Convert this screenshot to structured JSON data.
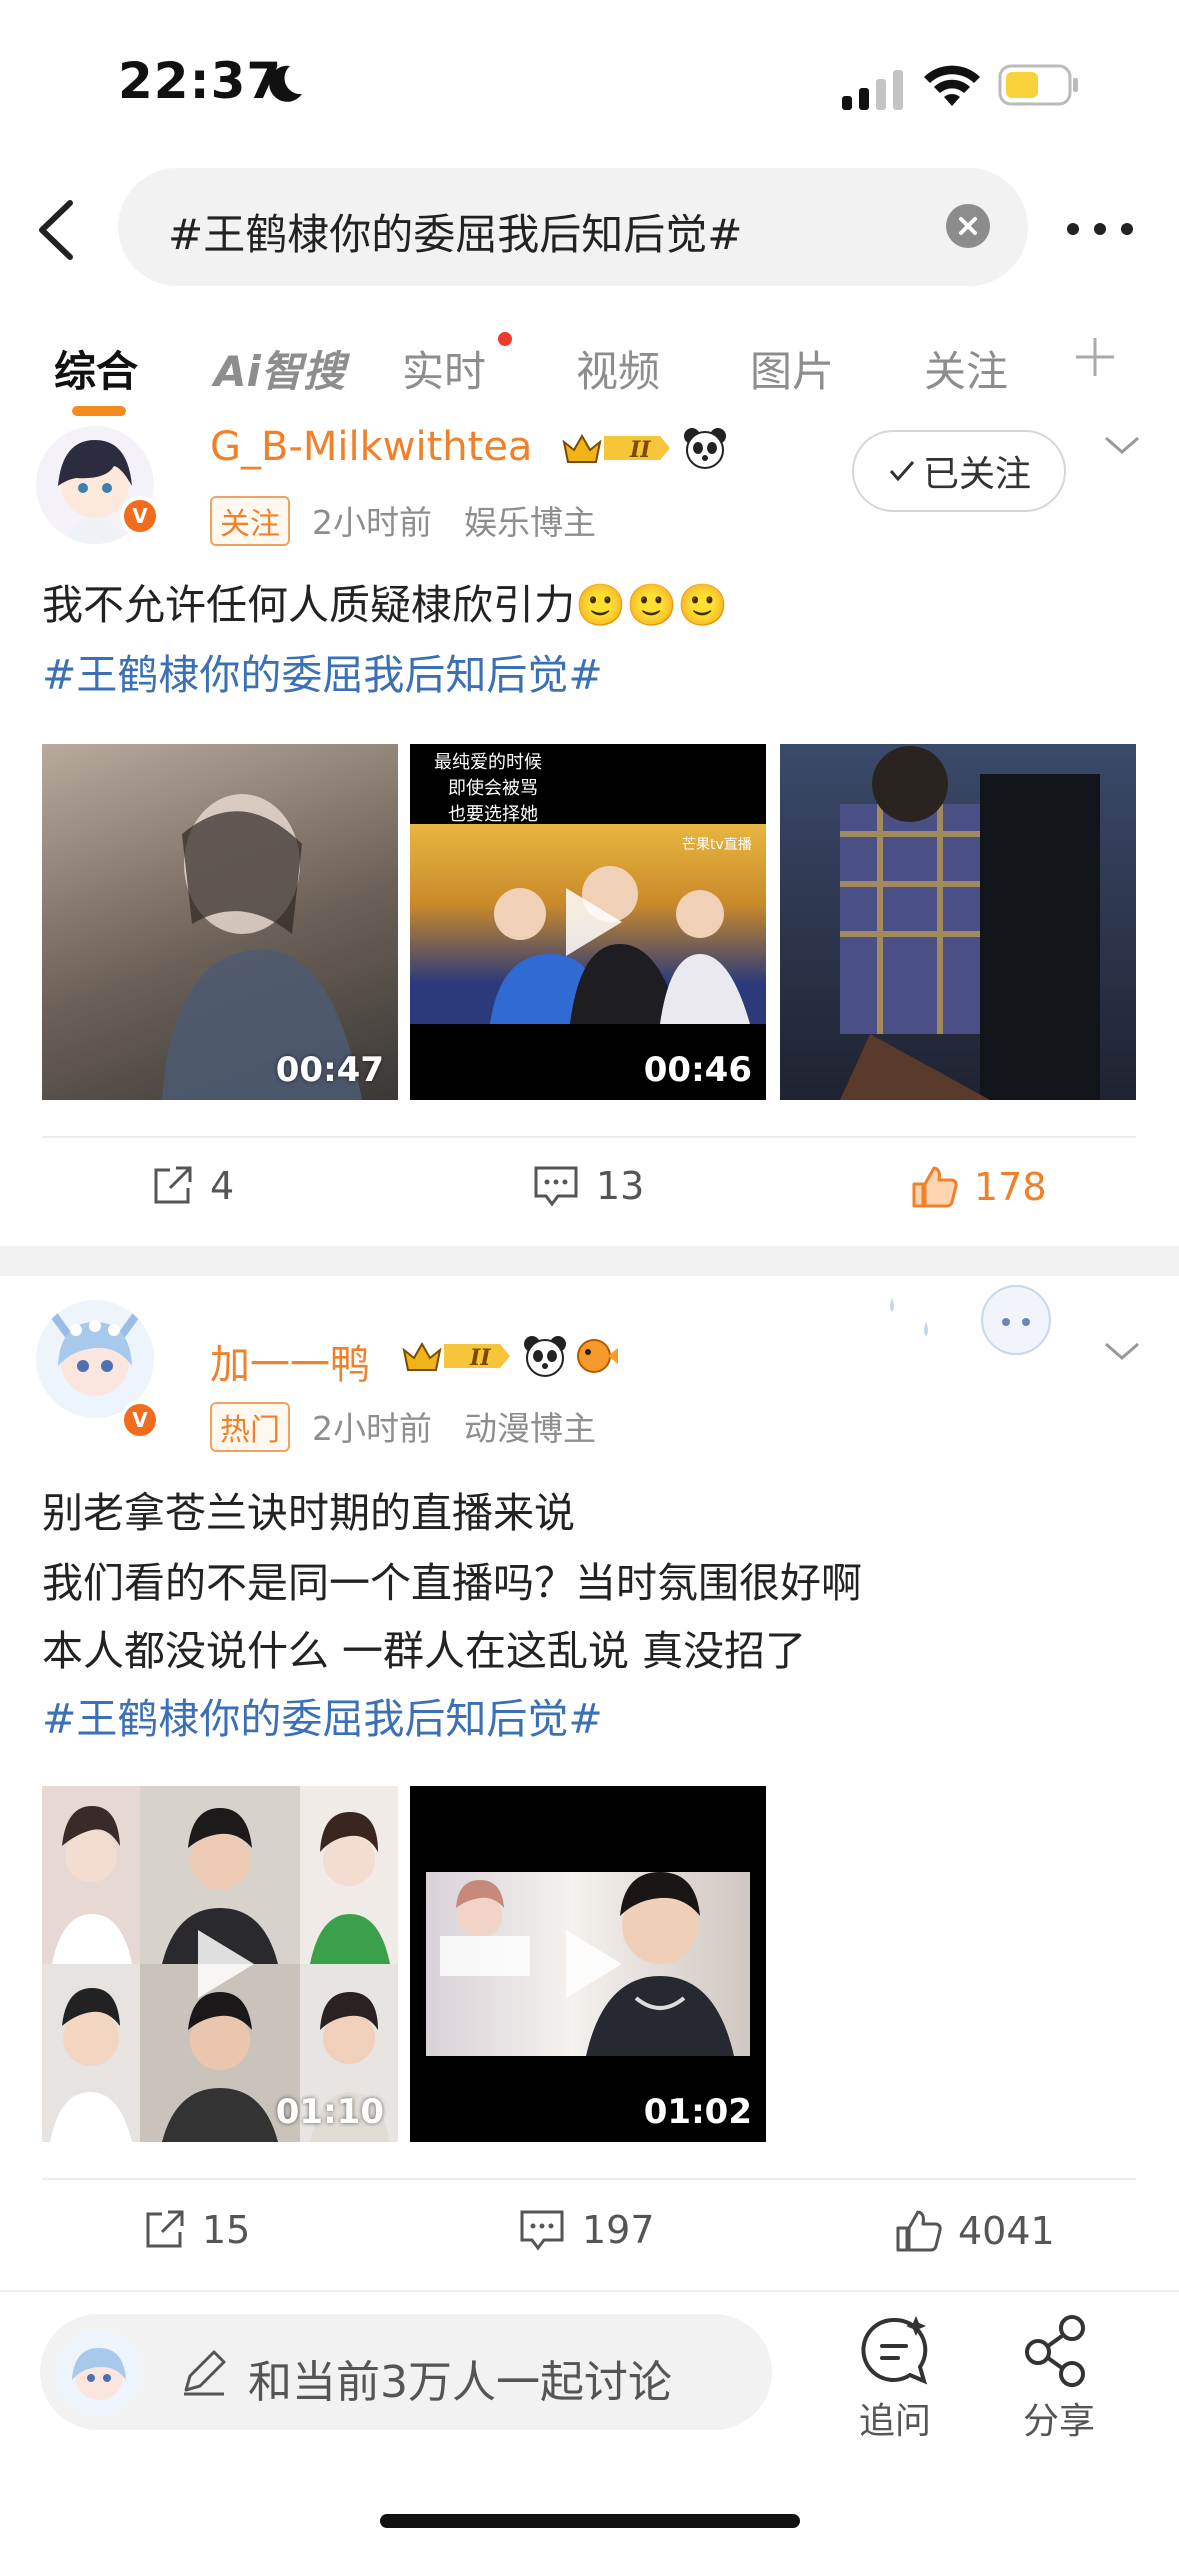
{
  "status_bar": {
    "time": "22:37"
  },
  "search": {
    "query": "#王鹤棣你的委屈我后知后觉#"
  },
  "tabs": [
    {
      "label": "综合",
      "active": true
    },
    {
      "label": "Ai智搜"
    },
    {
      "label": "实时",
      "has_dot": true
    },
    {
      "label": "视频"
    },
    {
      "label": "图片"
    },
    {
      "label": "关注"
    }
  ],
  "posts": [
    {
      "username": "G_B-Milkwithtea",
      "badge": "关注",
      "time": "2小时前",
      "category": "娱乐博主",
      "follow_label": "已关注",
      "lines": [
        "我不允许任何人质疑棣欣引力🙂🙂🙂"
      ],
      "topic": "#王鹤棣你的委屈我后知后觉#",
      "media": [
        {
          "duration": "00:47"
        },
        {
          "duration": "00:46",
          "caption_lines": [
            "最纯爱的时候",
            "即使会被骂",
            "也要选择她"
          ],
          "overlay_text": "芒果tv直播"
        },
        {
          "duration": ""
        }
      ],
      "actions": {
        "share": "4",
        "comment": "13",
        "like": "178"
      }
    },
    {
      "username": "加一一鸭",
      "badge": "热门",
      "time": "2小时前",
      "category": "动漫博主",
      "lines": [
        "别老拿苍兰诀时期的直播来说",
        "我们看的不是同一个直播吗？当时氛围很好啊",
        "本人都没说什么 一群人在这乱说 真没招了"
      ],
      "topic": "#王鹤棣你的委屈我后知后觉#",
      "media": [
        {
          "duration": "01:10"
        },
        {
          "duration": "01:02"
        }
      ],
      "actions": {
        "share": "15",
        "comment": "197",
        "like": "4041"
      }
    }
  ],
  "bottom_bar": {
    "discuss_placeholder": "和当前3万人一起讨论",
    "ask_label": "追问",
    "share_label": "分享"
  },
  "colors": {
    "accent": "#f0812a",
    "topic": "#3b6fb6",
    "like_active": "#f0812a"
  }
}
